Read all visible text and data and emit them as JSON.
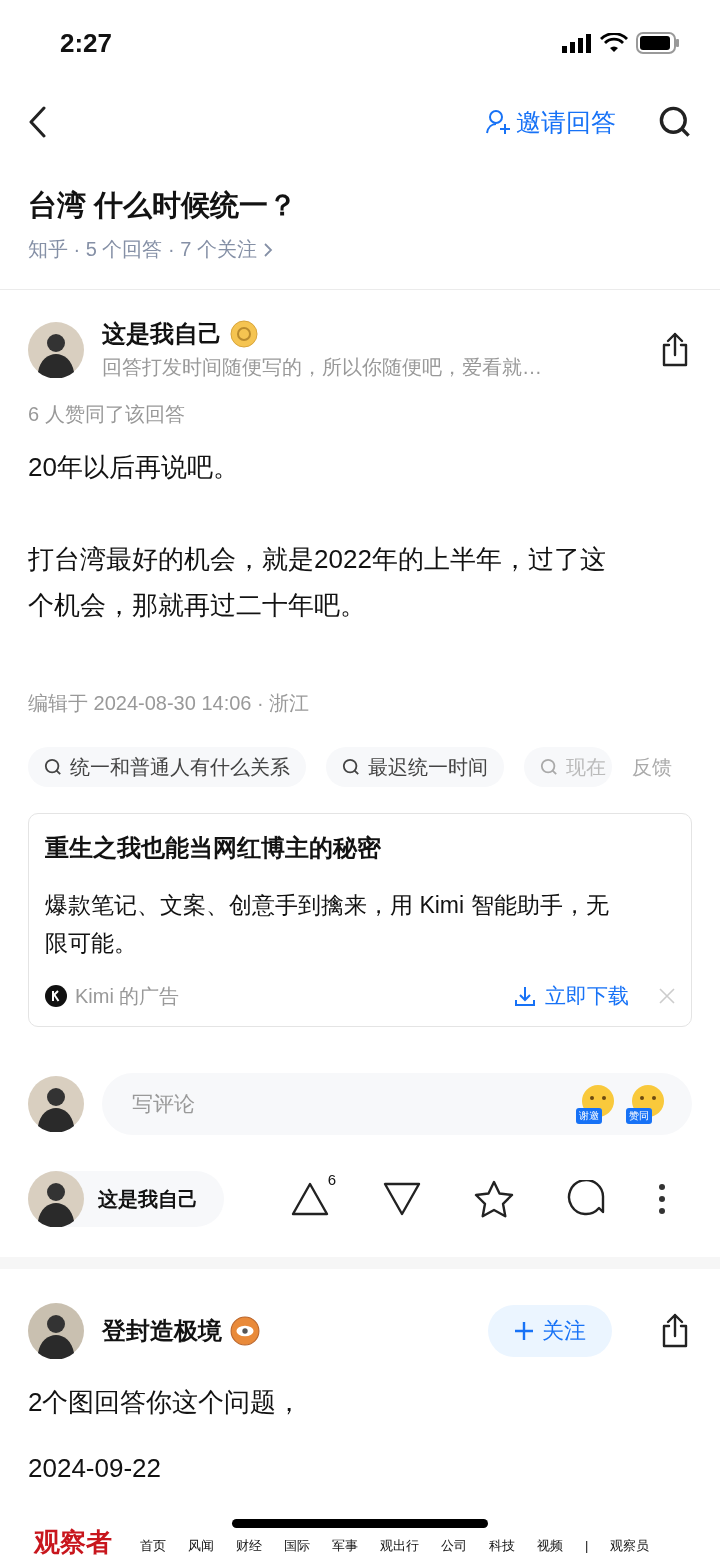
{
  "status_bar": {
    "time": "2:27"
  },
  "nav": {
    "invite": "邀请回答"
  },
  "question": {
    "title": "台湾 什么时候统一？",
    "meta": "知乎 · 5 个回答 · 7 个关注"
  },
  "answers": [
    {
      "author": "这是我自己",
      "badge": {
        "kind": "gold"
      },
      "bio": "回答打发时间随便写的，所以你随便吧，爱看就…",
      "upvote_note": "6 人赞同了该回答",
      "paragraphs": [
        "20年以后再说吧。",
        "打台湾最好的机会，就是2022年的上半年，过了这个机会，那就再过二十年吧。"
      ],
      "edited": "编辑于 2024-08-30 14:06 · 浙江",
      "related": [
        "统一和普通人有什么关系",
        "最迟统一时间",
        "现在"
      ],
      "feedback": "反馈",
      "ad": {
        "title": "重生之我也能当网红博主的秘密",
        "body": "爆款笔记、文案、创意手到擒来，用 Kimi 智能助手，无限可能。",
        "source": "Kimi 的广告",
        "action": "立即下载"
      },
      "comment": {
        "placeholder": "写评论",
        "stickers": [
          "谢邀",
          "赞同"
        ]
      },
      "actions": {
        "author": "这是我自己",
        "upvotes": "6"
      }
    },
    {
      "author": "登封造极境",
      "badge": {
        "kind": "eye"
      },
      "follow": "关注",
      "paragraphs": [
        "2个图回答你这个问题，",
        "2024-09-22"
      ],
      "image": {
        "logo": "观察者",
        "links": [
          "首页",
          "风闻",
          "财经",
          "国际",
          "军事",
          "观出行",
          "公司",
          "科技",
          "视频",
          "|",
          "观察员"
        ]
      }
    }
  ]
}
